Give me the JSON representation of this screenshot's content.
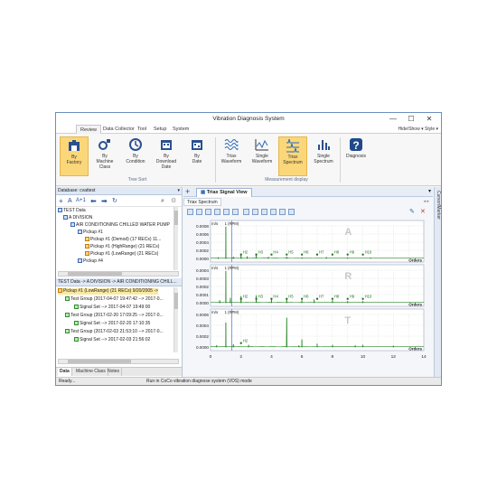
{
  "window": {
    "title": "Vibration Diagnosis System",
    "minimize": "—",
    "maximize": "☐",
    "close": "✕"
  },
  "menu": {
    "tabs": [
      "Review",
      "Data Collector",
      "Tool",
      "Setup",
      "System"
    ],
    "active": "Review",
    "right": "Hide/Show ▾   Style ▾"
  },
  "ribbon": {
    "tree_sort": {
      "label": "Tree Sort",
      "buttons": [
        {
          "label": "By\nFactory",
          "icon": "factory-icon",
          "selected": true
        },
        {
          "label": "By\nMachine\nClass",
          "icon": "machine-class-icon",
          "selected": false
        },
        {
          "label": "By\nCondition",
          "icon": "condition-icon",
          "selected": false
        },
        {
          "label": "By\nDownload\nDate",
          "icon": "calendar-download-icon",
          "selected": false
        },
        {
          "label": "By\nDate",
          "icon": "calendar-icon",
          "selected": false
        }
      ]
    },
    "measurement_display": {
      "label": "Measurement display",
      "buttons": [
        {
          "label": "Triax\nWaveform",
          "icon": "triax-waveform-icon",
          "selected": false
        },
        {
          "label": "Single\nWaveform",
          "icon": "single-waveform-icon",
          "selected": false
        },
        {
          "label": "Triax\nSpectrum",
          "icon": "triax-spectrum-icon",
          "selected": true
        },
        {
          "label": "Single\nSpectrum",
          "icon": "single-spectrum-icon",
          "selected": false
        }
      ]
    },
    "diagnosis": {
      "label": "Diagnosis",
      "icon": "diagnosis-icon"
    }
  },
  "left": {
    "db_title": "Database: cvattest",
    "tree": [
      {
        "text": "TEST Data",
        "level": 0
      },
      {
        "text": "A DIVISION",
        "level": 1
      },
      {
        "text": "AIR CONDITIONING CHILLED WATER PUMP",
        "level": 2
      },
      {
        "text": "Pickup #1",
        "level": 3
      },
      {
        "text": "Pickup #1 (Demod) (17 RECs) 11...",
        "level": 4
      },
      {
        "text": "Pickup #1 (HighRange) (21 RECs)",
        "level": 4
      },
      {
        "text": "Pickup #1 (LowRange) (21 RECs)",
        "level": 4
      },
      {
        "text": "Pickup #4",
        "level": 3
      }
    ],
    "path_title": "TEST Data -> A DIVISION -> AIR CONDITIONING CHILL...",
    "records": [
      {
        "text": "Pickup #1 (LowRange) (21 RECs) 9/20/2005 ->",
        "level": 0,
        "highlight": true
      },
      {
        "text": "Test Group (2017-04-07 19:47:42 --> 2017-0...",
        "level": 1
      },
      {
        "text": "Signal Set --> 2017-04-07 19:49:00",
        "level": 2
      },
      {
        "text": "Test Group (2017-02-20 17:09:25 --> 2017-0...",
        "level": 1
      },
      {
        "text": "Signal Set --> 2017-02-20 17:10:35",
        "level": 2
      },
      {
        "text": "Test Group (2017-02-03 21:53:10 --> 2017-0...",
        "level": 1
      },
      {
        "text": "Signal Set --> 2017-02-03 21:56:02",
        "level": 2
      }
    ],
    "bottom_tabs": [
      "Data",
      "Machine Class",
      "Notes"
    ]
  },
  "right": {
    "doc_tab": "Triax Signal View",
    "sub_tab": "Triax Spectrum",
    "cursor_label": "Cursor/Marker"
  },
  "status": {
    "left": "Ready...",
    "center": "Run in CoCo vibration diagnose system (VDS) mode"
  },
  "chart_data": {
    "type": "line",
    "xlim": [
      0,
      14
    ],
    "x_ticks": [
      "0",
      "2",
      "4",
      "6",
      "8",
      "10",
      "12",
      "14"
    ],
    "x_unit": "Orders",
    "y_unit": "m/s",
    "panels": [
      {
        "axis_label": "A",
        "ylim": [
          0,
          0.0008
        ],
        "y_ticks": [
          "0.0008",
          "0.0006",
          "0.0004",
          "0.0002",
          "0.0000"
        ],
        "peaks": [
          [
            0.5,
            2e-05
          ],
          [
            1.0,
            0.00078
          ],
          [
            1.5,
            4e-05
          ],
          [
            2.0,
            0.00012
          ],
          [
            2.4,
            5e-05
          ],
          [
            3.0,
            0.00012
          ],
          [
            3.8,
            4e-05
          ],
          [
            5.0,
            4e-05
          ],
          [
            6.0,
            2e-05
          ],
          [
            7.6,
            3e-05
          ],
          [
            9.0,
            2e-05
          ],
          [
            10.5,
            2e-05
          ]
        ],
        "markers": [
          "H2",
          "H3",
          "H4",
          "H5",
          "H6",
          "H7",
          "H8",
          "H9",
          "H10"
        ]
      },
      {
        "axis_label": "R",
        "ylim": [
          0,
          0.0004
        ],
        "y_ticks": [
          "0.0004",
          "0.0003",
          "0.0002",
          "0.0001",
          "0.0000"
        ],
        "peaks": [
          [
            0.6,
            3e-05
          ],
          [
            1.0,
            0.00039
          ],
          [
            1.3,
            6e-05
          ],
          [
            2.0,
            8e-05
          ],
          [
            3.0,
            9e-05
          ],
          [
            4.0,
            5e-05
          ],
          [
            5.0,
            4e-05
          ],
          [
            6.0,
            3e-05
          ],
          [
            6.8,
            4e-05
          ],
          [
            8.0,
            3e-05
          ],
          [
            9.0,
            2e-05
          ],
          [
            10.0,
            2e-05
          ]
        ],
        "markers": [
          "H2",
          "H3",
          "H4",
          "H5",
          "H6",
          "H7",
          "H8",
          "H9",
          "H10"
        ]
      },
      {
        "axis_label": "T",
        "ylim": [
          0,
          0.0006
        ],
        "y_ticks": [
          "0.0006",
          "0.0004",
          "0.0002",
          "0.0000"
        ],
        "peaks": [
          [
            0.4,
            3e-05
          ],
          [
            1.0,
            0.00045
          ],
          [
            1.5,
            5e-05
          ],
          [
            2.5,
            4e-05
          ],
          [
            5.0,
            0.00054
          ],
          [
            5.8,
            3e-05
          ],
          [
            6.0,
            0.00014
          ],
          [
            7.0,
            6e-05
          ],
          [
            8.0,
            4e-05
          ],
          [
            9.5,
            3e-05
          ],
          [
            10.0,
            4e-05
          ],
          [
            12.0,
            2e-05
          ]
        ],
        "markers": [
          "H2"
        ]
      }
    ],
    "cursor_label": "1 (RPM)"
  }
}
